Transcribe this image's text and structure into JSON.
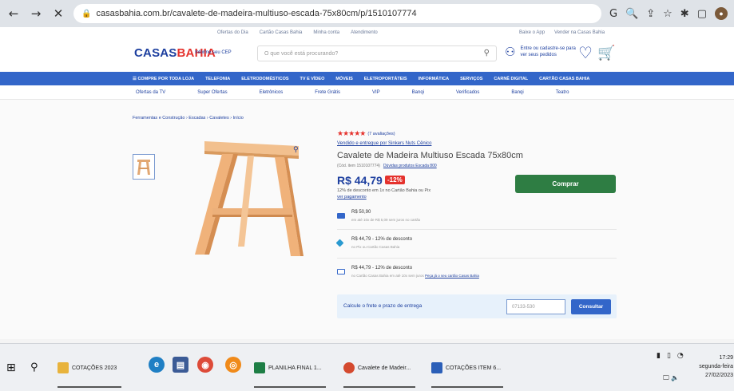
{
  "browser": {
    "url": "casasbahia.com.br/cavalete-de-madeira-multiuso-escada-75x80cm/p/1510107774",
    "back_icon": "←",
    "forward_icon": "→",
    "close_icon": "✕",
    "lock_icon": "🔒",
    "actions": [
      "G",
      "🔍",
      "⇪",
      "☆",
      "✱",
      "▢"
    ],
    "avatar": "●"
  },
  "site": {
    "top_links": [
      "Ofertas do Dia",
      "Cartão Casas Bahia",
      "Minha conta",
      "Atendimento"
    ],
    "right_links": [
      "Baixe o App",
      "Vender na Casas Bahia"
    ],
    "logo_a": "CASAS",
    "logo_b": "BAHIA",
    "cep": "Informe seu CEP",
    "search_placeholder": "O que você está procurando?",
    "search_icon": "⚲",
    "login_icon": "⚇",
    "login_text": "Entre ou cadastre-se para ver seus pedidos",
    "heart_icon": "♡",
    "cart_icon": "🛒"
  },
  "nav": [
    "☰ COMPRE POR TODA LOJA",
    "TELEFONIA",
    "ELETRODOMÉSTICOS",
    "TV E VÍDEO",
    "MÓVEIS",
    "ELETROPORTÁTEIS",
    "INFORMÁTICA",
    "SERVIÇOS",
    "CARNÊ DIGITAL",
    "CARTÃO CASAS BAHIA"
  ],
  "subnav": [
    "Ofertas da TV",
    "Super Ofertas",
    "Eletrônicos",
    "Frete Grátis",
    "VIP",
    "Banqi",
    "Verificados",
    "Banqi",
    "Teatro"
  ],
  "product": {
    "breadcrumb": "Ferramentas e Construção › Escadas › Cavaletes › Início",
    "stars": "★★★★★",
    "reviews": "(7 avaliações)",
    "seller": "Vendido e entregue por Sinkers Nuts Cênico",
    "title": "Cavalete de Madeira Multiuso Escada 75x80cm",
    "code": "(Cód. item 1510107774)",
    "code_link": "Dúvidas produtos Escada 800",
    "price": "R$ 44,79",
    "badge": "-12%",
    "discount_text": "12% de desconto em 1x no Cartão Bahia ou Pix",
    "see_payment": "ver pagamento",
    "buy_label": "Comprar",
    "zoom_icon": "⚲"
  },
  "payments": [
    {
      "line1": "R$ 50,90",
      "line2": "em até 10x de R$ 5,09 sem juros no cartão"
    },
    {
      "line1": "R$ 44,79 - 12% de desconto",
      "line2": "no Pix ou Cartão Casas Bahia"
    },
    {
      "line1": "R$ 44,79 - 12% de desconto",
      "line2": "no Cartão Casas Bahia em até 10x sem juros ",
      "link": "Peça já o seu cartão Casas Bahia"
    }
  ],
  "freight": {
    "label": "Calcule o frete e prazo de entrega",
    "cep_placeholder": "07133-530",
    "button": "Consultar"
  },
  "taskbar": {
    "start_icon": "⊞",
    "search_icon": "⚲",
    "apps": [
      {
        "label": "COTAÇÕES 2023",
        "color": "#e8b33c"
      },
      {
        "label": "PLANILHA FINAL 1...",
        "color": "#1e7e45"
      },
      {
        "label": "Cavalete de Madeir...",
        "color": "#d44a2f"
      },
      {
        "label": "COTAÇÕES ITEM 6...",
        "color": "#2b5fb8"
      }
    ],
    "tray": [
      "▮",
      "▯",
      "◔"
    ],
    "time": "17:29",
    "day": "segunda-feira",
    "date": "27/02/2023",
    "tray2": "🖵 🔈"
  },
  "colors": {
    "brand_blue": "#1d3f9f",
    "brand_red": "#e5322d",
    "buy_green": "#2e7d43"
  }
}
